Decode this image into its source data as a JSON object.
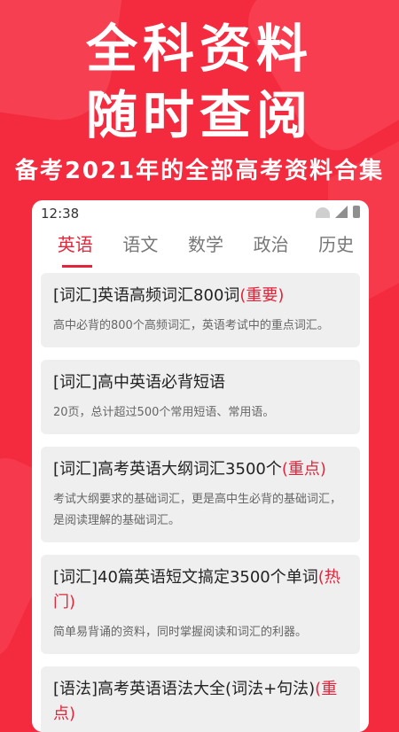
{
  "promo": {
    "line1": "全科资料",
    "line2": "随时查阅",
    "subtitle": "备考2021年的全部高考资料合集"
  },
  "status_bar": {
    "time": "12:38"
  },
  "tabs": [
    "英语",
    "语文",
    "数学",
    "政治",
    "历史"
  ],
  "active_tab": "英语",
  "accent_color": "#e2253a",
  "items": [
    {
      "title": "[词汇]英语高频词汇800词",
      "tag": "(重要)",
      "desc": "高中必背的800个高频词汇，英语考试中的重点词汇。"
    },
    {
      "title": "[词汇]高中英语必背短语",
      "tag": "",
      "desc": "20页，总计超过500个常用短语、常用语。"
    },
    {
      "title": "[词汇]高考英语大纲词汇3500个",
      "tag": "(重点)",
      "desc": "考试大纲要求的基础词汇，更是高中生必背的基础词汇，是阅读理解的基础词汇。"
    },
    {
      "title": "[词汇]40篇英语短文搞定3500个单词",
      "tag": "(热门)",
      "desc": "简单易背诵的资料，同时掌握阅读和词汇的利器。"
    },
    {
      "title": "[语法]高考英语语法大全(词法+句法)",
      "tag": "(重点)",
      "desc": ""
    }
  ]
}
